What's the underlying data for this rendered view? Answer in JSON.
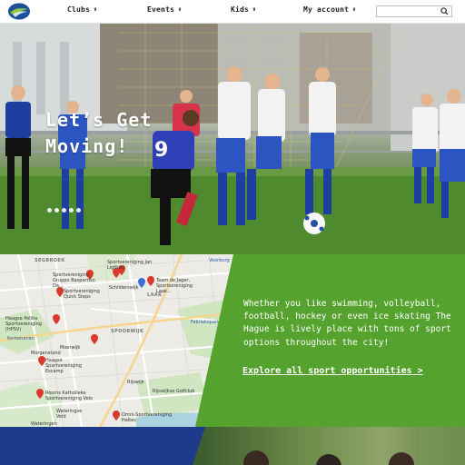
{
  "nav": {
    "items": [
      {
        "label": "Clubs"
      },
      {
        "label": "Events"
      },
      {
        "label": "Kids"
      },
      {
        "label": "My account"
      }
    ],
    "search": {
      "placeholder": "",
      "value": ""
    }
  },
  "hero": {
    "title_line1": "Let’s Get",
    "title_line2": "Moving!",
    "slide_count": 5,
    "jersey_number": "9"
  },
  "map": {
    "labels": [
      {
        "text": "SEGBROEK",
        "kind": "area"
      },
      {
        "text": "Sportvereniging Jan Ligthart",
        "kind": "poi"
      },
      {
        "text": "Sportvereniging Gruppo Basportivo Da...",
        "kind": "poi"
      },
      {
        "text": "Team de Jager, Sportvereniging Laak...",
        "kind": "poi"
      },
      {
        "text": "Sportvereniging Quick Steps",
        "kind": "poi"
      },
      {
        "text": "Schilderswijk",
        "kind": "area"
      },
      {
        "text": "LAAK",
        "kind": "area"
      },
      {
        "text": "Voorburg",
        "kind": "place"
      },
      {
        "text": "Haagse Politie Sportvereniging (HPSV)",
        "kind": "poi"
      },
      {
        "text": "Fabriekspark",
        "kind": "place"
      },
      {
        "text": "Kerketuinen",
        "kind": "place"
      },
      {
        "text": "Moerwijk",
        "kind": "area"
      },
      {
        "text": "SPOORWIJK",
        "kind": "area"
      },
      {
        "text": "Morgenstond",
        "kind": "area"
      },
      {
        "text": "Haagse Sportvereniging Escamp",
        "kind": "poi"
      },
      {
        "text": "Rooms Katholieke Sportvereniging Velo",
        "kind": "poi"
      },
      {
        "text": "Rijswijk",
        "kind": "area"
      },
      {
        "text": "Rijswijkse Golfclub",
        "kind": "poi"
      },
      {
        "text": "Omni-Sportvereniging Haltes",
        "kind": "poi"
      },
      {
        "text": "Wateringse Veld",
        "kind": "area"
      },
      {
        "text": "Wateringen",
        "kind": "area"
      }
    ]
  },
  "info": {
    "text": "Whether you like swimming, volleyball, football, hockey or even ice skating The Hague is lively place with tons of sport options throughout the city!",
    "link": "Explore all sport opportunities >"
  },
  "colors": {
    "green": "#55a22e",
    "navy": "#1e3a8a",
    "pin": "#d93a2b"
  },
  "icons": {
    "logo": "club-logo-icon",
    "search": "search-icon",
    "chevron": "chevron-down-icon",
    "pin": "map-pin-icon"
  }
}
